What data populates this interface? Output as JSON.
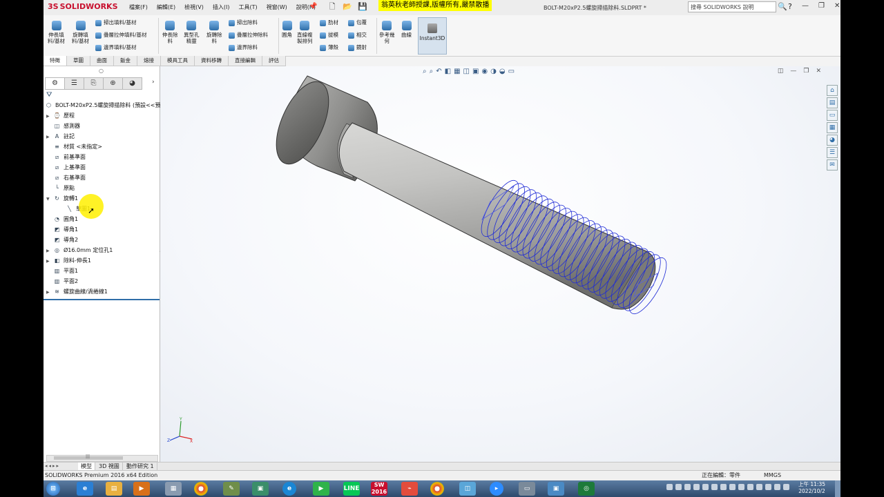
{
  "app": {
    "logo": "SOLIDWORKS",
    "menu": [
      "檔案(F)",
      "編輯(E)",
      "檢視(V)",
      "插入(I)",
      "工具(T)",
      "視窗(W)",
      "說明(H)"
    ],
    "banner": "翁英秋老師授課,版權所有,嚴禁散播",
    "doc_title": "BOLT-M20xP2.5螺旋掃描除料.SLDPRT *",
    "search_placeholder": "搜尋 SOLIDWORKS 說明",
    "help_label": "?",
    "window_controls": {
      "minimize": "—",
      "restore": "❐",
      "close": "✕"
    }
  },
  "ribbon": {
    "extrude_boss": "伸長填\n料/基材",
    "revolve_boss": "旋轉填\n料/基材",
    "swept_boss": "掃出填料/基材",
    "lofted_boss": "疊層拉伸填料/基材",
    "boundary_boss": "邊界填料/基材",
    "extrude_cut": "伸長除\n料",
    "hole_wizard": "異型孔\n精靈",
    "revolve_cut": "旋轉除\n料",
    "swept_cut": "掃出除料",
    "lofted_cut": "疊層拉伸除料",
    "boundary_cut": "邊界除料",
    "fillet": "圓角",
    "linear_pattern": "直線複\n製排列",
    "rib": "肋材",
    "draft": "拔模",
    "shell": "薄殼",
    "wrap": "包覆",
    "intersect": "相交",
    "mirror": "鏡射",
    "ref_geometry": "參考幾\n何",
    "curves": "曲線",
    "instant3d": "Instant3D"
  },
  "command_tabs": [
    "特徵",
    "草圖",
    "曲面",
    "鈑金",
    "熔接",
    "模具工具",
    "資料移轉",
    "直接編輯",
    "評估"
  ],
  "feature_tree": {
    "root": "BOLT-M20xP2.5螺旋掃描除料 (預設<<預",
    "items": [
      {
        "label": "歷程",
        "icon": "history-icon",
        "exp": "▶"
      },
      {
        "label": "感測器",
        "icon": "sensor-icon",
        "exp": ""
      },
      {
        "label": "註記",
        "icon": "annotation-icon",
        "exp": "▶"
      },
      {
        "label": "材質 <未指定>",
        "icon": "material-icon",
        "exp": ""
      },
      {
        "label": "前基準面",
        "icon": "plane-icon",
        "exp": ""
      },
      {
        "label": "上基準面",
        "icon": "plane-icon",
        "exp": ""
      },
      {
        "label": "右基準面",
        "icon": "plane-icon",
        "exp": ""
      },
      {
        "label": "原點",
        "icon": "origin-icon",
        "exp": ""
      },
      {
        "label": "旋轉1",
        "icon": "revolve-icon",
        "exp": "▼"
      },
      {
        "label": "草圖1",
        "icon": "sketch-icon",
        "exp": "",
        "child": true
      },
      {
        "label": "圓角1",
        "icon": "fillet-icon",
        "exp": ""
      },
      {
        "label": "導角1",
        "icon": "chamfer-icon",
        "exp": ""
      },
      {
        "label": "導角2",
        "icon": "chamfer-icon",
        "exp": ""
      },
      {
        "label": "Ø16.0mm 定位孔1",
        "icon": "hole-icon",
        "exp": "▶"
      },
      {
        "label": "除料-伸長1",
        "icon": "cut-extrude-icon",
        "exp": "▶"
      },
      {
        "label": "平面1",
        "icon": "plane-icon",
        "exp": ""
      },
      {
        "label": "平面2",
        "icon": "plane-icon",
        "exp": ""
      },
      {
        "label": "螺旋曲線/渦捲線1",
        "icon": "helix-icon",
        "exp": "▶"
      }
    ]
  },
  "bottom_tabs": [
    "模型",
    "3D 視圖",
    "動作研究 1"
  ],
  "status": {
    "left": "SOLIDWORKS Premium 2016 x64 Edition",
    "editing": "正在編輯：零件",
    "units": "MMGS"
  },
  "taskbar": {
    "clock_time": "上午 11:35",
    "clock_date": "2022/10/2",
    "solidworks_badge": "2016"
  },
  "colors": {
    "accent": "#2f6ea8",
    "banner": "#ffff00",
    "helix": "#1f2bd6",
    "logo": "#c8102e"
  }
}
